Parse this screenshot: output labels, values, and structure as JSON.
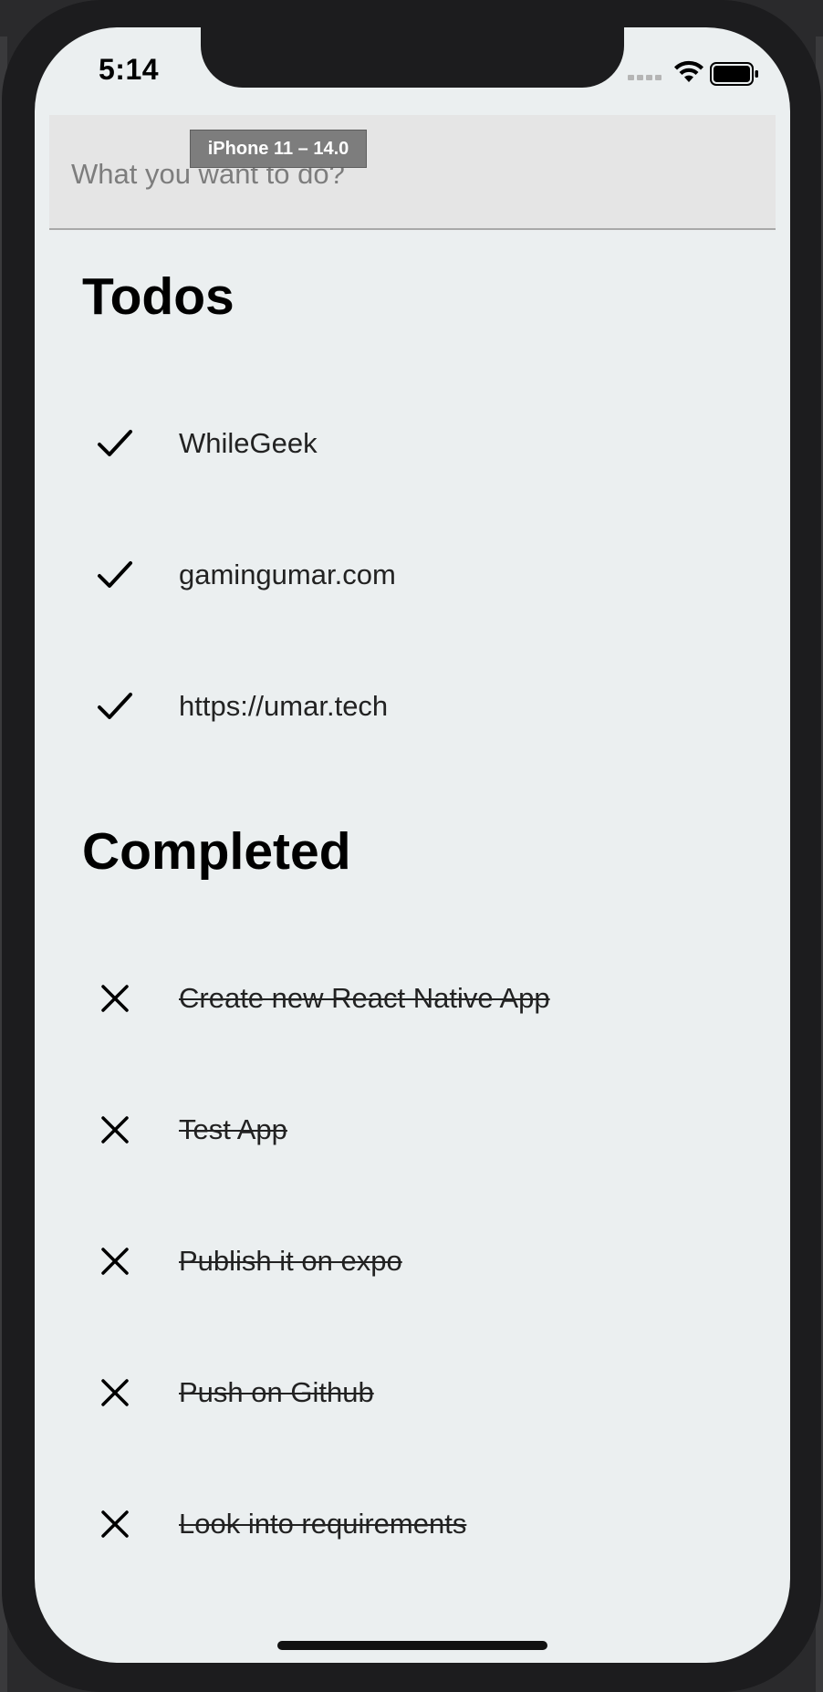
{
  "status_bar": {
    "time": "5:14"
  },
  "simulator": {
    "device_label": "iPhone 11 – 14.0"
  },
  "input": {
    "placeholder": "What you want to do?",
    "value": ""
  },
  "todos": {
    "title": "Todos",
    "items": [
      {
        "text": "WhileGeek",
        "icon": "checkmark-icon"
      },
      {
        "text": "gamingumar.com",
        "icon": "checkmark-icon"
      },
      {
        "text": "https://umar.tech",
        "icon": "checkmark-icon"
      }
    ]
  },
  "completed": {
    "title": "Completed",
    "items": [
      {
        "text": "Create new React Native App",
        "icon": "close-icon"
      },
      {
        "text": "Test App",
        "icon": "close-icon"
      },
      {
        "text": "Publish it on expo",
        "icon": "close-icon"
      },
      {
        "text": "Push on Github",
        "icon": "close-icon"
      },
      {
        "text": "Look into requirements",
        "icon": "close-icon"
      }
    ]
  },
  "colors": {
    "screen_background": "#ebeff0",
    "input_background": "#e5e5e5",
    "text": "#222222"
  }
}
